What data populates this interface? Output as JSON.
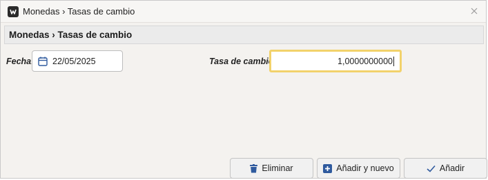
{
  "window": {
    "title": "Monedas › Tasas de cambio",
    "close_glyph": "✕"
  },
  "header": {
    "title": "Monedas › Tasas de cambio"
  },
  "form": {
    "fecha_label": "Fecha:",
    "fecha_value": "22/05/2025",
    "tasa_label": "Tasa de cambio:",
    "tasa_value": "1,0000000000"
  },
  "buttons": {
    "eliminar": "Eliminar",
    "anadir_nuevo": "Añadir y nuevo",
    "anadir": "Añadir"
  },
  "colors": {
    "focus_border": "#f2d26b",
    "icon_blue": "#2f5a9e"
  }
}
